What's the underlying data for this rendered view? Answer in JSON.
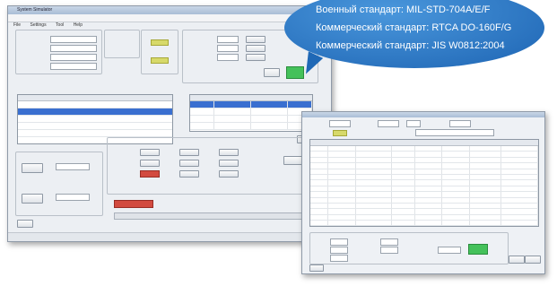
{
  "callout": {
    "line1": "Военный стандарт: MIL-STD-704A/E/F",
    "line2": "Коммерческий стандарт: RTCA DO-160F/G",
    "line3": "Коммерческий стандарт: JIS W0812:2004"
  },
  "colors": {
    "callout_blue": "#1d64b3",
    "status_green": "#44c15a",
    "status_red": "#d24a3f",
    "selection_blue": "#3a6fd0"
  },
  "main_window": {
    "title": "System Simulator",
    "menu": [
      "File",
      "Settings",
      "Tool",
      "Help"
    ],
    "list_rows": [
      "",
      "",
      "",
      "",
      "",
      ""
    ],
    "table_rows": [
      [
        "",
        "",
        "",
        ""
      ],
      [
        "",
        "",
        "",
        ""
      ],
      [
        "",
        "",
        "",
        ""
      ],
      [
        "",
        "",
        "",
        ""
      ]
    ],
    "status_items": [
      "",
      "",
      ""
    ]
  },
  "second_window": {
    "rows": [
      [
        "",
        "",
        "",
        "",
        "",
        "",
        "",
        ""
      ],
      [
        "",
        "",
        "",
        "",
        "",
        "",
        "",
        ""
      ],
      [
        "",
        "",
        "",
        "",
        "",
        "",
        "",
        ""
      ],
      [
        "",
        "",
        "",
        "",
        "",
        "",
        "",
        ""
      ],
      [
        "",
        "",
        "",
        "",
        "",
        "",
        "",
        ""
      ],
      [
        "",
        "",
        "",
        "",
        "",
        "",
        "",
        ""
      ],
      [
        "",
        "",
        "",
        "",
        "",
        "",
        "",
        ""
      ],
      [
        "",
        "",
        "",
        "",
        "",
        "",
        "",
        ""
      ],
      [
        "",
        "",
        "",
        "",
        "",
        "",
        "",
        ""
      ],
      [
        "",
        "",
        "",
        "",
        "",
        "",
        "",
        ""
      ],
      [
        "",
        "",
        "",
        "",
        "",
        "",
        "",
        ""
      ],
      [
        "",
        "",
        "",
        "",
        "",
        "",
        "",
        ""
      ],
      [
        "",
        "",
        "",
        "",
        "",
        "",
        "",
        ""
      ],
      [
        "",
        "",
        "",
        "",
        "",
        "",
        "",
        ""
      ],
      [
        "",
        "",
        "",
        "",
        "",
        "",
        "",
        ""
      ]
    ]
  }
}
